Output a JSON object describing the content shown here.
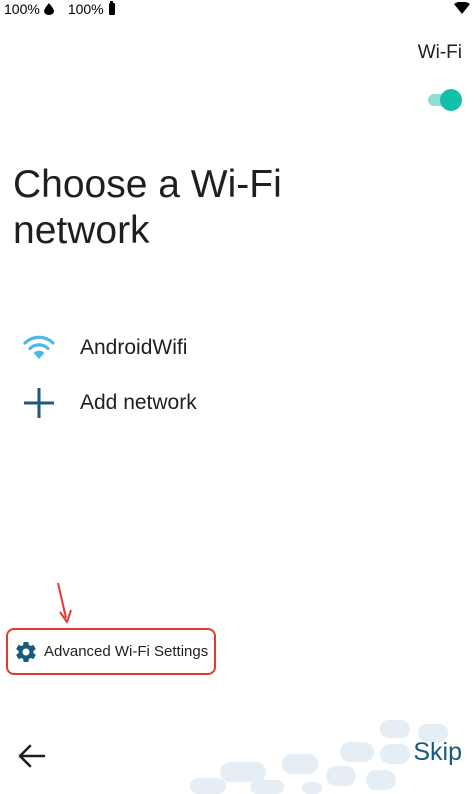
{
  "status_bar": {
    "battery_left": "100%",
    "battery_right": "100%"
  },
  "wifi_toggle": {
    "label": "Wi-Fi",
    "enabled": true
  },
  "title": "Choose a Wi-Fi network",
  "networks": [
    {
      "label": "AndroidWifi",
      "icon": "wifi-icon"
    },
    {
      "label": "Add network",
      "icon": "plus-icon"
    }
  ],
  "advanced_settings": {
    "label": "Advanced Wi-Fi Settings",
    "icon": "gear-icon"
  },
  "nav": {
    "back_icon": "back-arrow-icon",
    "skip_label": "Skip"
  },
  "colors": {
    "accent": "#14bfa9",
    "wifi_blue": "#4fb8e8",
    "plus_blue": "#1a5a7a",
    "highlight_red": "#e53935"
  }
}
